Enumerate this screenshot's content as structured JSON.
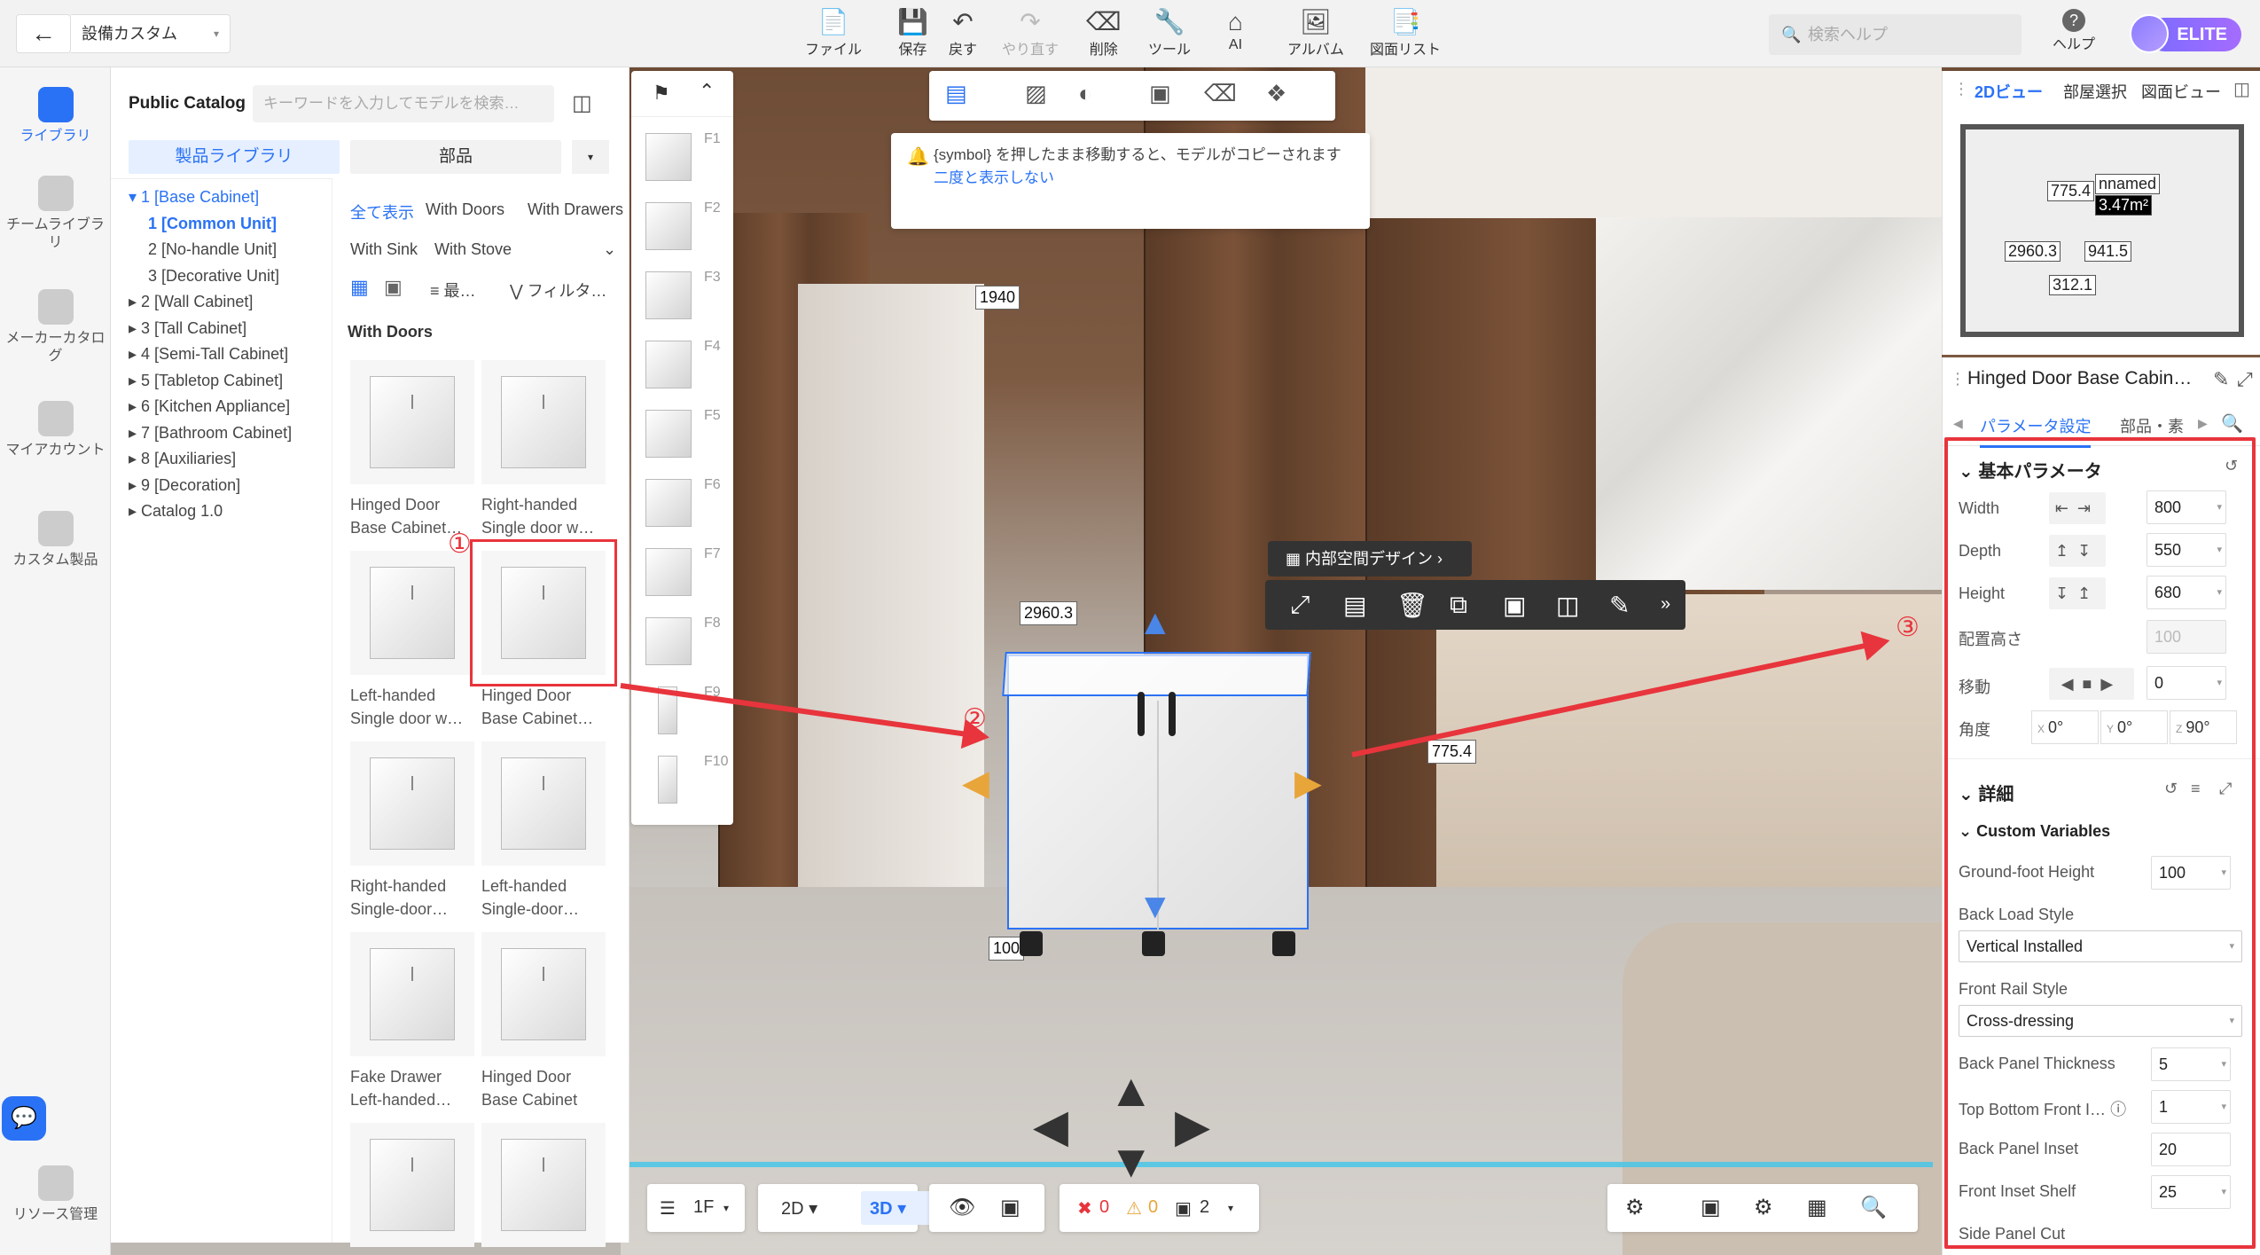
{
  "header": {
    "back_icon": "arrow-left-icon",
    "project_select": "設備カスタム",
    "toolbar": [
      {
        "label": "ファイル",
        "icon": "file-icon",
        "enabled": true
      },
      {
        "label": "保存",
        "icon": "save-icon",
        "enabled": true
      },
      {
        "label": "戻す",
        "icon": "undo-icon",
        "enabled": true
      },
      {
        "label": "やり直す",
        "icon": "redo-icon",
        "enabled": false
      },
      {
        "label": "削除",
        "icon": "eraser-icon",
        "enabled": true
      },
      {
        "label": "ツール",
        "icon": "wrench-icon",
        "enabled": true
      },
      {
        "label": "AI",
        "icon": "ai-house-icon",
        "enabled": true
      },
      {
        "label": "アルバム",
        "icon": "album-icon",
        "enabled": true
      },
      {
        "label": "図面リスト",
        "icon": "drawing-list-icon",
        "enabled": true
      }
    ],
    "search_placeholder": "検索ヘルプ",
    "help_label": "ヘルプ",
    "badge": "ELITE"
  },
  "left_rail": [
    {
      "label": "ライブラリ",
      "active": true
    },
    {
      "label": "チームライブラリ",
      "active": false
    },
    {
      "label": "メーカーカタログ",
      "active": false
    },
    {
      "label": "マイアカウント",
      "active": false
    },
    {
      "label": "カスタム製品",
      "active": false
    },
    {
      "label": "リソース管理",
      "active": false
    }
  ],
  "catalog": {
    "title": "Public Catalog",
    "search_placeholder": "キーワードを入力してモデルを検索…",
    "tab_library": "製品ライブラリ",
    "tab_parts": "部品",
    "tree": [
      {
        "label": "1 [Base Cabinet]",
        "level": 0,
        "active": true,
        "expanded": true
      },
      {
        "label": "1 [Common Unit]",
        "level": 1,
        "active": true
      },
      {
        "label": "2 [No-handle Unit]",
        "level": 1,
        "active": false
      },
      {
        "label": "3 [Decorative Unit]",
        "level": 1,
        "active": false
      },
      {
        "label": "2 [Wall Cabinet]",
        "level": 0,
        "active": false
      },
      {
        "label": "3 [Tall Cabinet]",
        "level": 0,
        "active": false
      },
      {
        "label": "4 [Semi-Tall Cabinet]",
        "level": 0,
        "active": false
      },
      {
        "label": "5 [Tabletop Cabinet]",
        "level": 0,
        "active": false
      },
      {
        "label": "6 [Kitchen Appliance]",
        "level": 0,
        "active": false
      },
      {
        "label": "7 [Bathroom Cabinet]",
        "level": 0,
        "active": false
      },
      {
        "label": "8 [Auxiliaries]",
        "level": 0,
        "active": false
      },
      {
        "label": "9 [Decoration]",
        "level": 0,
        "active": false
      },
      {
        "label": "Catalog 1.0",
        "level": 0,
        "active": false
      }
    ],
    "filters_row1": [
      "全て表示",
      "With Doors",
      "With Drawers"
    ],
    "filters_row2": [
      "With Sink",
      "With Stove"
    ],
    "sort_label": "最…",
    "filter_label": "フィルタ…",
    "section": "With Doors",
    "products": [
      {
        "line1": "Hinged Door",
        "line2": "Base Cabinet…",
        "selected": false
      },
      {
        "line1": "Right-handed",
        "line2": "Single door w…",
        "selected": false
      },
      {
        "line1": "Left-handed",
        "line2": "Single door w…",
        "selected": false
      },
      {
        "line1": "Hinged Door",
        "line2": "Base Cabinet…",
        "selected": true
      },
      {
        "line1": "Right-handed",
        "line2": "Single-door…",
        "selected": false
      },
      {
        "line1": "Left-handed",
        "line2": "Single-door…",
        "selected": false
      },
      {
        "line1": "Fake Drawer",
        "line2": "Left-handed…",
        "selected": false
      },
      {
        "line1": "Hinged Door",
        "line2": "Base Cabinet",
        "selected": false
      },
      {
        "line1": "",
        "line2": "",
        "selected": false
      },
      {
        "line1": "",
        "line2": "",
        "selected": false
      }
    ]
  },
  "fstrip": [
    "F1",
    "F2",
    "F3",
    "F4",
    "F5",
    "F6",
    "F7",
    "F8",
    "F9",
    "F10"
  ],
  "tip": {
    "text": "{symbol} を押したまま移動すると、モデルがコピーされます",
    "link": "二度と表示しない"
  },
  "scene": {
    "dims": {
      "height_top": "1940",
      "width": "2960.3",
      "side": "775.4",
      "bottom": "100"
    },
    "interior_button": "内部空間デザイン",
    "annotations": [
      "①",
      "②",
      "③"
    ]
  },
  "bottom": {
    "floor": "1F",
    "view2d": "2D",
    "view3d": "3D",
    "errors": "0",
    "warnings": "0",
    "layers": "2"
  },
  "minimap": {
    "tabs": [
      "2Dビュー",
      "部屋選択",
      "図面ビュー"
    ],
    "labels": {
      "a": "775.4",
      "b": "2960.3",
      "c": "941.5",
      "d": "312.1",
      "room": "nnamed",
      "area": "3.47m²"
    }
  },
  "properties": {
    "title": "Hinged Door Base Cabin…",
    "tabs": [
      "パラメータ設定",
      "部品・素"
    ],
    "basic_section": "基本パラメータ",
    "width": {
      "label": "Width",
      "value": "800"
    },
    "depth": {
      "label": "Depth",
      "value": "550"
    },
    "height": {
      "label": "Height",
      "value": "680"
    },
    "elevation": {
      "label": "配置高さ",
      "value": "100"
    },
    "move": {
      "label": "移動",
      "value": "0"
    },
    "angle": {
      "label": "角度",
      "x": "0°",
      "y": "0°",
      "z": "90°"
    },
    "detail_section": "詳細",
    "custom_section": "Custom Variables",
    "ground_foot": {
      "label": "Ground-foot Height",
      "value": "100"
    },
    "back_load": {
      "label": "Back Load Style",
      "value": "Vertical Installed"
    },
    "front_rail": {
      "label": "Front Rail Style",
      "value": "Cross-dressing"
    },
    "back_thickness": {
      "label": "Back Panel Thickness",
      "value": "5"
    },
    "top_bottom": {
      "label": "Top Bottom Front I…",
      "value": "1"
    },
    "back_inset": {
      "label": "Back Panel Inset",
      "value": "20"
    },
    "front_inset": {
      "label": "Front Inset Shelf",
      "value": "25"
    },
    "side_cut": {
      "label": "Side Panel Cut"
    }
  },
  "colors": {
    "accent": "#2a72f5",
    "annotation": "#e8343c",
    "elite": "#8a6cff"
  }
}
